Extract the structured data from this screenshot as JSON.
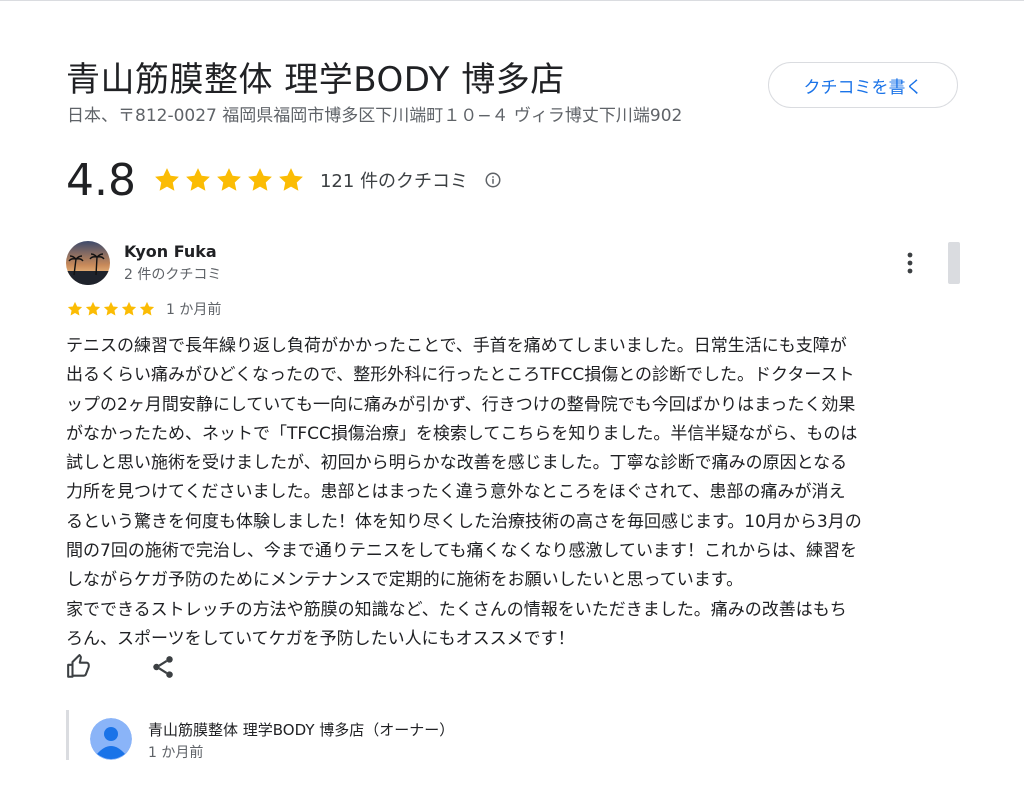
{
  "business": {
    "name": "青山筋膜整体 理学BODY 博多店",
    "address": "日本、〒812-0027 福岡県福岡市博多区下川端町１０−４ ヴィラ博丈下川端902"
  },
  "actions": {
    "write_review_label": "クチコミを書く"
  },
  "rating_summary": {
    "score": "4.8",
    "stars": 5,
    "review_count_label": "121 件のクチコミ"
  },
  "review": {
    "author": "Kyon Fuka",
    "author_review_count": "2 件のクチコミ",
    "stars": 5,
    "date": "1 か月前",
    "text": "テニスの練習で長年繰り返し負荷がかかったことで、手首を痛めてしまいました。日常生活にも支障が\n出るくらい痛みがひどくなったので、整形外科に行ったところTFCC損傷との診断でした。ドクタースト\nップの2ヶ月間安静にしていても一向に痛みが引かず、行きつけの整骨院でも今回ばかりはまったく効果\nがなかったため、ネットで「TFCC損傷治療」を検索してこちらを知りました。半信半疑ながら、ものは\n試しと思い施術を受けましたが、初回から明らかな改善を感じました。丁寧な診断で痛みの原因となる\n力所を見つけてくださいました。患部とはまったく違う意外なところをほぐされて、患部の痛みが消え\nるという驚きを何度も体験しました！体を知り尽くした治療技術の高さを毎回感じます。10月から3月の\n間の7回の施術で完治し、今まで通りテニスをしても痛くなくなり感激しています！これからは、練習を\nしながらケガ予防のためにメンテナンスで定期的に施術をお願いしたいと思っています。\n家でできるストレッチの方法や筋膜の知識など、たくさんの情報をいただきました。痛みの改善はもち\nろん、スポーツをしていてケガを予防したい人にもオススメです！"
  },
  "owner_reply": {
    "name": "青山筋膜整体 理学BODY 博多店（オーナー）",
    "date": "1 か月前"
  },
  "colors": {
    "star": "#fbbc04",
    "link": "#1a73e8",
    "muted": "#5f6368",
    "owner_avatar": "#8ab4f8"
  },
  "icons": [
    "star-icon",
    "info-icon",
    "more-vert-icon",
    "thumb-up-icon",
    "share-icon",
    "person-icon"
  ]
}
